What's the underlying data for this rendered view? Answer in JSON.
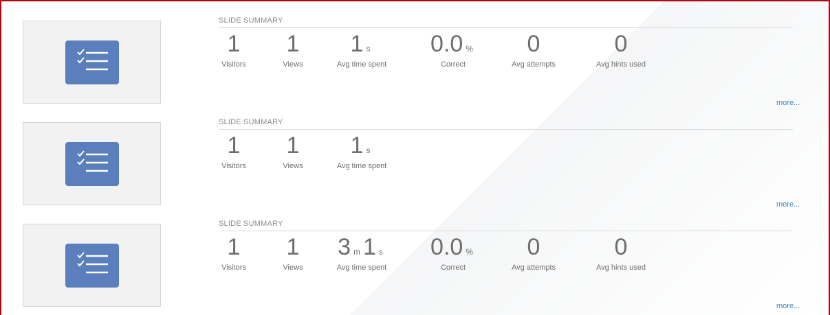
{
  "slides": [
    {
      "header": "SLIDE SUMMARY",
      "stats": [
        {
          "value": "1",
          "label": "Visitors"
        },
        {
          "value": "1",
          "label": "Views"
        },
        {
          "value": "1",
          "unit": "s",
          "label": "Avg time spent"
        },
        {
          "value": "0.0",
          "unit": "%",
          "label": "Correct"
        },
        {
          "value": "0",
          "label": "Avg attempts"
        },
        {
          "value": "0",
          "label": "Avg hints used"
        }
      ],
      "more": "more..."
    },
    {
      "header": "SLIDE SUMMARY",
      "stats": [
        {
          "value": "1",
          "label": "Visitors"
        },
        {
          "value": "1",
          "label": "Views"
        },
        {
          "value": "1",
          "unit": "s",
          "label": "Avg time spent"
        }
      ],
      "more": "more..."
    },
    {
      "header": "SLIDE SUMMARY",
      "stats": [
        {
          "value": "1",
          "label": "Visitors"
        },
        {
          "value": "1",
          "label": "Views"
        },
        {
          "value": "3",
          "unit": "m",
          "value2": "1",
          "unit2": "s",
          "label": "Avg time spent"
        },
        {
          "value": "0.0",
          "unit": "%",
          "label": "Correct"
        },
        {
          "value": "0",
          "label": "Avg attempts"
        },
        {
          "value": "0",
          "label": "Avg hints used"
        }
      ],
      "more": "more..."
    }
  ],
  "icon": "quiz-checklist-icon",
  "colors": {
    "frame_border": "#b00a10",
    "icon_bg": "#5b7fbd",
    "link": "#3b8bcc",
    "text": "#6d6d6d"
  }
}
